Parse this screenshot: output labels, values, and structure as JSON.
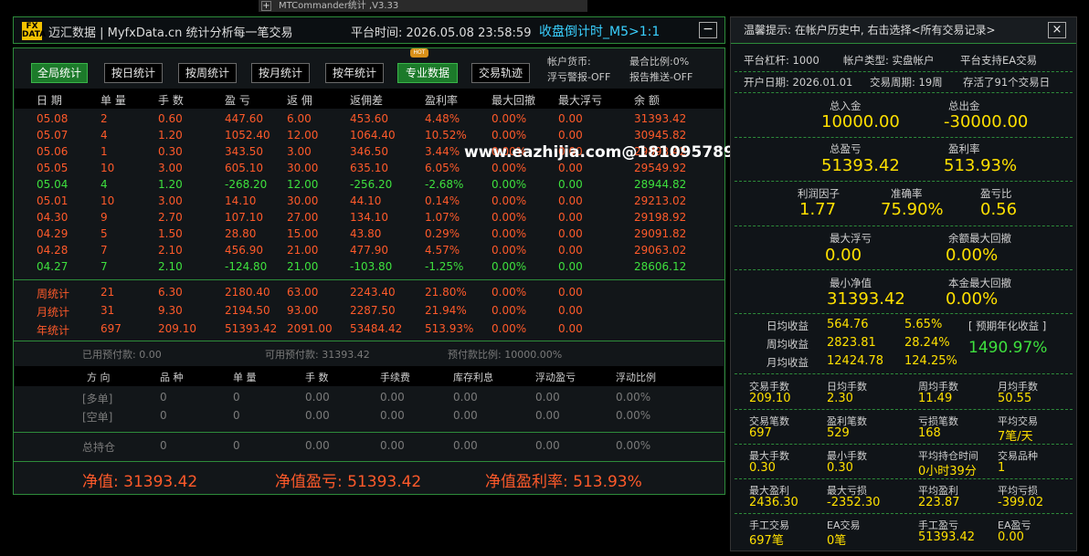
{
  "window": {
    "title": "MTCommander统计 ,V3.33",
    "plus": "+"
  },
  "header": {
    "logo_top": "FX",
    "logo_bottom": "DATA",
    "brand": "迈汇数据 | MyfxData.cn  统计分析每一笔交易",
    "platform_time": "平台时间: 2026.05.08 23:58:59",
    "countdown": "收盘倒计时_M5>1:1",
    "minimize": "−"
  },
  "toolbar": {
    "buttons": [
      "全局统计",
      "按日统计",
      "按周统计",
      "按月统计",
      "按年统计",
      "专业数据",
      "交易轨迹"
    ],
    "hot_badge": "HOT",
    "account_currency": "帐户货币:",
    "float_alert": "浮亏警报-OFF",
    "margin_ratio": "最合比例:0%",
    "report_push": "报告推送-OFF"
  },
  "table": {
    "columns": [
      "日 期",
      "单 量",
      "手 数",
      "盈 亏",
      "返 佣",
      "返佣差",
      "盈利率",
      "最大回撤",
      "最大浮亏",
      "余 额"
    ],
    "rows": [
      [
        "05.08",
        "2",
        "0.60",
        "447.60",
        "6.00",
        "453.60",
        "4.48%",
        "0.00%",
        "0.00",
        "31393.42"
      ],
      [
        "05.07",
        "4",
        "1.20",
        "1052.40",
        "12.00",
        "1064.40",
        "10.52%",
        "0.00%",
        "0.00",
        "30945.82"
      ],
      [
        "05.06",
        "1",
        "0.30",
        "343.50",
        "3.00",
        "346.50",
        "3.44%",
        "0.00%",
        "0.00",
        "29893.42"
      ],
      [
        "05.05",
        "10",
        "3.00",
        "605.10",
        "30.00",
        "635.10",
        "6.05%",
        "0.00%",
        "0.00",
        "29549.92"
      ],
      [
        "05.04",
        "4",
        "1.20",
        "-268.20",
        "12.00",
        "-256.20",
        "-2.68%",
        "0.00%",
        "0.00",
        "28944.82"
      ],
      [
        "05.01",
        "10",
        "3.00",
        "14.10",
        "30.00",
        "44.10",
        "0.14%",
        "0.00%",
        "0.00",
        "29213.02"
      ],
      [
        "04.30",
        "9",
        "2.70",
        "107.10",
        "27.00",
        "134.10",
        "1.07%",
        "0.00%",
        "0.00",
        "29198.92"
      ],
      [
        "04.29",
        "5",
        "1.50",
        "28.80",
        "15.00",
        "43.80",
        "0.29%",
        "0.00%",
        "0.00",
        "29091.82"
      ],
      [
        "04.28",
        "7",
        "2.10",
        "456.90",
        "21.00",
        "477.90",
        "4.57%",
        "0.00%",
        "0.00",
        "29063.02"
      ],
      [
        "04.27",
        "7",
        "2.10",
        "-124.80",
        "21.00",
        "-103.80",
        "-1.25%",
        "0.00%",
        "0.00",
        "28606.12"
      ]
    ],
    "row_status": [
      "profit",
      "profit",
      "profit",
      "profit",
      "loss",
      "profit",
      "profit",
      "profit",
      "profit",
      "loss"
    ],
    "summary": [
      [
        "周统计",
        "21",
        "6.30",
        "2180.40",
        "63.00",
        "2243.40",
        "21.80%",
        "0.00%",
        "0.00"
      ],
      [
        "月统计",
        "31",
        "9.30",
        "2194.50",
        "93.00",
        "2287.50",
        "21.94%",
        "0.00%",
        "0.00"
      ],
      [
        "年统计",
        "697",
        "209.10",
        "51393.42",
        "2091.00",
        "53484.42",
        "513.93%",
        "0.00%",
        "0.00"
      ]
    ]
  },
  "prepay": {
    "used": "已用预付款: 0.00",
    "available": "可用预付款: 31393.42",
    "ratio": "预付款比例: 10000.00%"
  },
  "positions": {
    "columns": [
      "方 向",
      "品 种",
      "单 量",
      "手 数",
      "手续费",
      "库存利息",
      "浮动盈亏",
      "浮动比例"
    ],
    "rows": [
      [
        "[多单]",
        "0",
        "0",
        "0.00",
        "0.00",
        "0.00",
        "0.00",
        "0.00%"
      ],
      [
        "[空单]",
        "0",
        "0",
        "0.00",
        "0.00",
        "0.00",
        "0.00",
        "0.00%"
      ]
    ],
    "total": [
      "总持仓",
      "0",
      "0",
      "0.00",
      "0.00",
      "0.00",
      "0.00",
      "0.00%"
    ]
  },
  "footer": {
    "equity": "净值: 31393.42",
    "equity_pl": "净值盈亏: 51393.42",
    "equity_rate": "净值盈利率: 513.93%"
  },
  "watermark": "www.eazhijia.com@18109578915",
  "side": {
    "tip": "温馨提示: 在帐户历史中, 右击选择<所有交易记录>",
    "close": "×",
    "leverage": "平台杠杆: 1000",
    "account_type": "帐户类型: 实盘帐户",
    "ea_support": "平台支持EA交易",
    "open_date": "开户日期: 2026.01.01",
    "trade_weeks": "交易周期: 19周",
    "saved_days": "存活了91个交易日",
    "total_in_label": "总入金",
    "total_in": "10000.00",
    "total_out_label": "总出金",
    "total_out": "-30000.00",
    "total_pl_label": "总盈亏",
    "total_pl": "51393.42",
    "profit_rate_label": "盈利率",
    "profit_rate": "513.93%",
    "pf_label": "利润因子",
    "pf": "1.77",
    "accuracy_label": "准确率",
    "accuracy": "75.90%",
    "rr_label": "盈亏比",
    "rr": "0.56",
    "max_float_label": "最大浮亏",
    "max_float": "0.00",
    "max_bal_dd_label": "余额最大回撤",
    "max_bal_dd": "0.00%",
    "min_equity_label": "最小净值",
    "min_equity": "31393.42",
    "max_principal_dd_label": "本金最大回撤",
    "max_principal_dd": "0.00%",
    "daily_label": "日均收益",
    "daily_val": "564.76",
    "daily_pct": "5.65%",
    "weekly_label": "周均收益",
    "weekly_val": "2823.81",
    "weekly_pct": "28.24%",
    "monthly_label": "月均收益",
    "monthly_val": "12424.78",
    "monthly_pct": "124.25%",
    "annual_label": "[ 预期年化收益 ]",
    "annual_val": "1490.97%",
    "stats": [
      [
        [
          "交易手数",
          "209.10"
        ],
        [
          "日均手数",
          "2.30"
        ],
        [
          "周均手数",
          "11.49"
        ],
        [
          "月均手数",
          "50.55"
        ]
      ],
      [
        [
          "交易笔数",
          "697"
        ],
        [
          "盈利笔数",
          "529"
        ],
        [
          "亏损笔数",
          "168"
        ],
        [
          "平均交易",
          "7笔/天"
        ]
      ],
      [
        [
          "最大手数",
          "0.30"
        ],
        [
          "最小手数",
          "0.30"
        ],
        [
          "平均持仓时间",
          "0小时39分"
        ],
        [
          "交易品种",
          "1"
        ]
      ],
      [
        [
          "最大盈利",
          "2436.30"
        ],
        [
          "最大亏损",
          "-2352.30"
        ],
        [
          "平均盈利",
          "223.87"
        ],
        [
          "平均亏损",
          "-399.02"
        ]
      ],
      [
        [
          "手工交易",
          "697笔"
        ],
        [
          "EA交易",
          "0笔"
        ],
        [
          "手工盈亏",
          "51393.42"
        ],
        [
          "EA盈亏",
          "0.00"
        ]
      ]
    ]
  }
}
